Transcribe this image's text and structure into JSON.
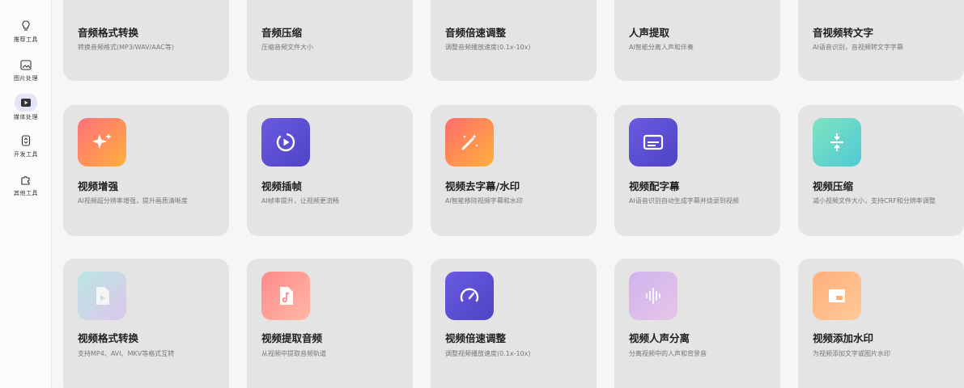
{
  "sidebar": {
    "items": [
      {
        "label": "推荐工具",
        "icon": "lightbulb-icon",
        "active": false
      },
      {
        "label": "图片处理",
        "icon": "image-icon",
        "active": false
      },
      {
        "label": "媒体处理",
        "icon": "media-icon",
        "active": true
      },
      {
        "label": "开发工具",
        "icon": "code-icon",
        "active": false
      },
      {
        "label": "其他工具",
        "icon": "puzzle-icon",
        "active": false
      }
    ]
  },
  "rows": [
    {
      "cards": [
        {
          "title": "音频格式转换",
          "desc": "转换音频格式(MP3/WAV/AAC等)"
        },
        {
          "title": "音频压缩",
          "desc": "压缩音频文件大小"
        },
        {
          "title": "音频倍速调整",
          "desc": "调整音频播放速度(0.1x-10x)"
        },
        {
          "title": "人声提取",
          "desc": "AI智能分离人声和伴奏"
        },
        {
          "title": "音视频转文字",
          "desc": "AI语音识别，音视频转文字字幕"
        }
      ]
    },
    {
      "cards": [
        {
          "title": "视频增强",
          "desc": "AI视频超分辨率增强，提升画质清晰度",
          "icon": "sparkle-icon"
        },
        {
          "title": "视频插帧",
          "desc": "AI帧率提升，让视频更流畅",
          "icon": "play-circle-icon"
        },
        {
          "title": "视频去字幕/水印",
          "desc": "AI智能移除视频字幕和水印",
          "icon": "magic-wand-icon"
        },
        {
          "title": "视频配字幕",
          "desc": "AI语音识别自动生成字幕并烧录到视频",
          "icon": "subtitle-icon"
        },
        {
          "title": "视频压缩",
          "desc": "减小视频文件大小，支持CRF和分辨率调整",
          "icon": "compress-icon"
        }
      ]
    },
    {
      "cards": [
        {
          "title": "视频格式转换",
          "desc": "支持MP4、AVI、MKV等格式互转",
          "icon": "video-file-icon"
        },
        {
          "title": "视频提取音频",
          "desc": "从视频中提取音频轨道",
          "icon": "music-file-icon"
        },
        {
          "title": "视频倍速调整",
          "desc": "调整视频播放速度(0.1x-10x)",
          "icon": "speedometer-icon"
        },
        {
          "title": "视频人声分离",
          "desc": "分离视频中的人声和背景音",
          "icon": "waveform-icon"
        },
        {
          "title": "视频添加水印",
          "desc": "为视频添加文字或图片水印",
          "icon": "watermark-icon"
        }
      ]
    }
  ],
  "colors": {
    "sidebar_active": "#e3e4f7",
    "card_bg": "#e4e4e5",
    "accent": "#6a5ce0"
  }
}
